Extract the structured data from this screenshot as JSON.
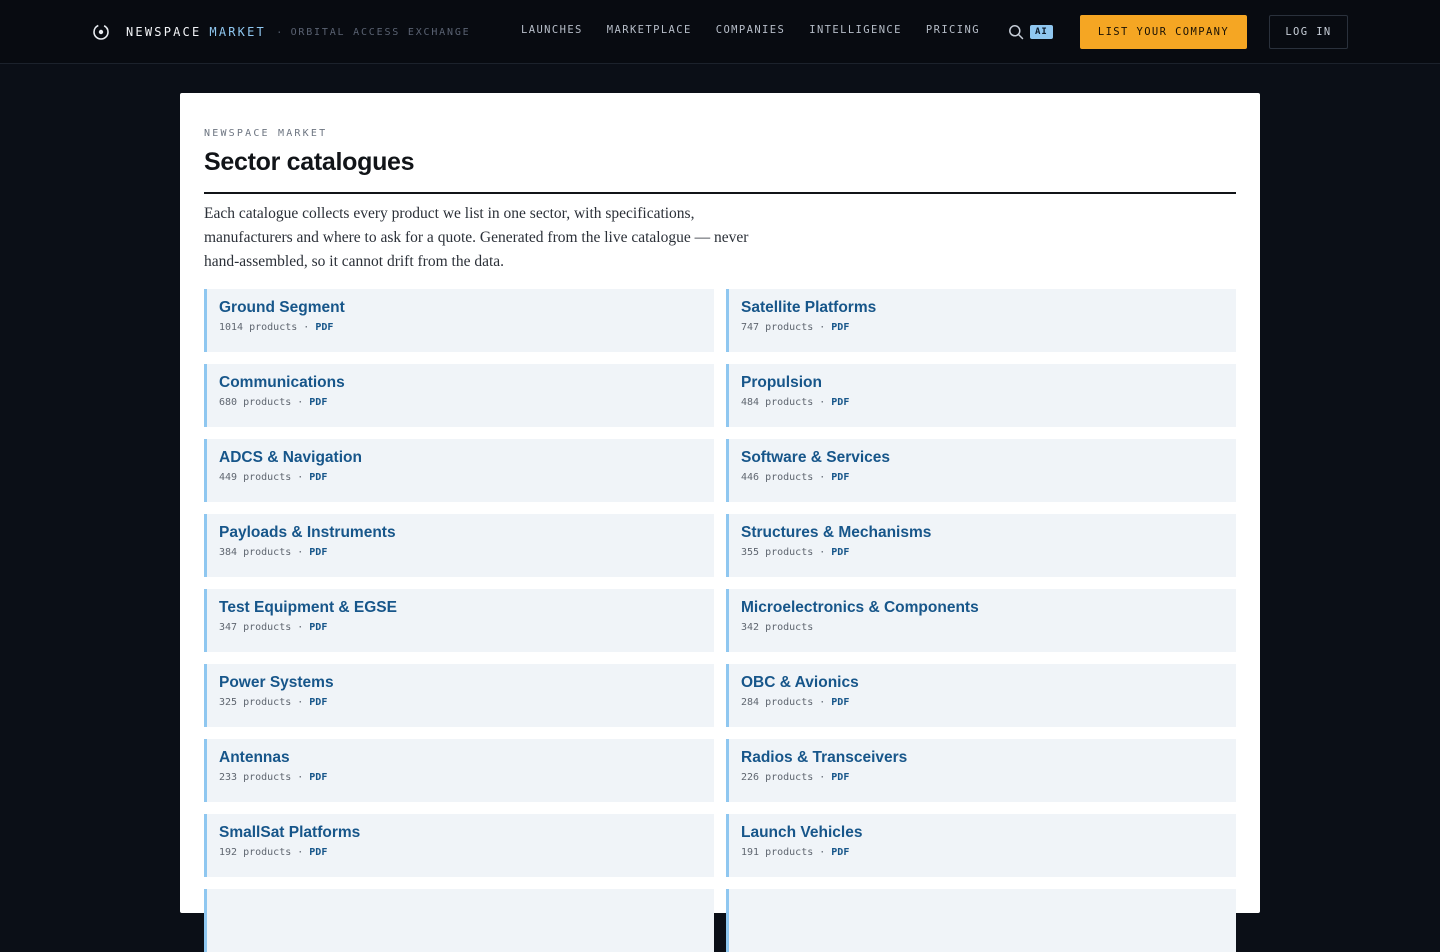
{
  "header": {
    "brand_name": "NEWSPACE",
    "brand_accent": "MARKET",
    "brand_separator": "·",
    "brand_tagline": "ORBITAL ACCESS EXCHANGE",
    "nav": [
      "LAUNCHES",
      "MARKETPLACE",
      "COMPANIES",
      "INTELLIGENCE",
      "PRICING"
    ],
    "search_icon": "search-icon",
    "ai_badge": "AI",
    "cta_label": "LIST YOUR COMPANY",
    "login_label": "LOG IN",
    "colors": {
      "accent": "#f5a623",
      "brand_blue": "#8fc7f0",
      "background": "#080b11"
    }
  },
  "main": {
    "eyebrow": "NEWSPACE MARKET",
    "title": "Sector catalogues",
    "intro": "Each catalogue collects every product we list in one sector, with specifications, manufacturers and where to ask for a quote. Generated from the live catalogue — never hand-assembled, so it cannot drift from the data.",
    "separator": "·",
    "catalogues": [
      {
        "name": "Ground Segment",
        "count": "1014 products",
        "pdf": "PDF"
      },
      {
        "name": "Satellite Platforms",
        "count": "747 products",
        "pdf": "PDF"
      },
      {
        "name": "Communications",
        "count": "680 products",
        "pdf": "PDF"
      },
      {
        "name": "Propulsion",
        "count": "484 products",
        "pdf": "PDF"
      },
      {
        "name": "ADCS & Navigation",
        "count": "449 products",
        "pdf": "PDF"
      },
      {
        "name": "Software & Services",
        "count": "446 products",
        "pdf": "PDF"
      },
      {
        "name": "Payloads & Instruments",
        "count": "384 products",
        "pdf": "PDF"
      },
      {
        "name": "Structures & Mechanisms",
        "count": "355 products",
        "pdf": "PDF"
      },
      {
        "name": "Test Equipment & EGSE",
        "count": "347 products",
        "pdf": "PDF"
      },
      {
        "name": "Microelectronics & Components",
        "count": "342 products",
        "pdf": ""
      },
      {
        "name": "Power Systems",
        "count": "325 products",
        "pdf": "PDF"
      },
      {
        "name": "OBC & Avionics",
        "count": "284 products",
        "pdf": "PDF"
      },
      {
        "name": "Antennas",
        "count": "233 products",
        "pdf": "PDF"
      },
      {
        "name": "Radios & Transceivers",
        "count": "226 products",
        "pdf": "PDF"
      },
      {
        "name": "SmallSat Platforms",
        "count": "192 products",
        "pdf": "PDF"
      },
      {
        "name": "Launch Vehicles",
        "count": "191 products",
        "pdf": "PDF"
      },
      {
        "name": "",
        "count": "",
        "pdf": ""
      },
      {
        "name": "",
        "count": "",
        "pdf": ""
      }
    ],
    "colors": {
      "card_border": "#8fc7f0",
      "card_bg": "#f0f4f8",
      "link": "#17568a"
    }
  }
}
